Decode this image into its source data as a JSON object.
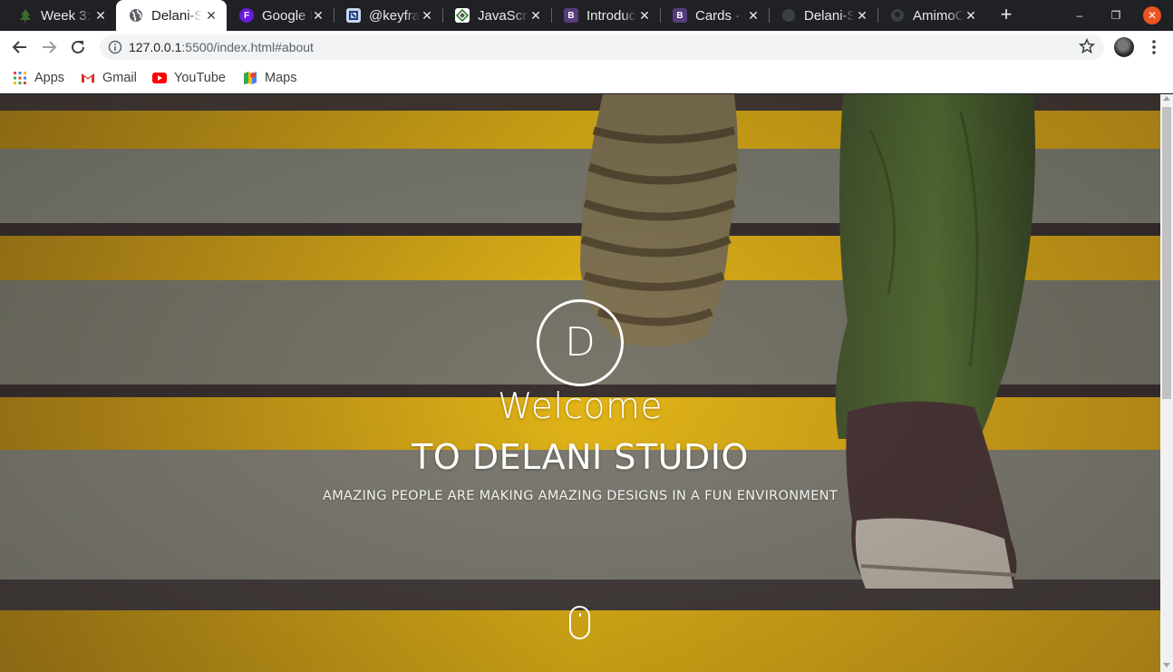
{
  "browser": {
    "tabs": [
      {
        "title": "Week 3:",
        "icon": "tree-favicon",
        "active": false
      },
      {
        "title": "Delani-S",
        "icon": "globe-favicon",
        "active": true
      },
      {
        "title": "Google F",
        "icon": "google-fonts-favicon",
        "active": false
      },
      {
        "title": "@keyfra",
        "icon": "keyframes-favicon",
        "active": false
      },
      {
        "title": "JavaScri",
        "icon": "javascript-favicon",
        "active": false
      },
      {
        "title": "Introduc",
        "icon": "bootstrap-favicon",
        "active": false
      },
      {
        "title": "Cards · B",
        "icon": "bootstrap-favicon",
        "active": false
      },
      {
        "title": "Delani-S",
        "icon": "globe-favicon",
        "active": false
      },
      {
        "title": "AmimoC",
        "icon": "github-favicon",
        "active": false
      }
    ],
    "tab_close_glyph": "✕",
    "new_tab_glyph": "+",
    "window_controls": {
      "minimize": "–",
      "maximize": "❐",
      "close": "✕"
    },
    "url": {
      "host": "127.0.0.1",
      "rest": ":5500/index.html#about"
    },
    "bookmarks": [
      {
        "label": "Apps",
        "icon": "apps-grid-icon"
      },
      {
        "label": "Gmail",
        "icon": "gmail-icon"
      },
      {
        "label": "YouTube",
        "icon": "youtube-icon"
      },
      {
        "label": "Maps",
        "icon": "maps-icon"
      }
    ]
  },
  "hero": {
    "logo_letter": "D",
    "welcome": "Welcome",
    "heading": "TO DELANI STUDIO",
    "tagline": "AMAZING PEOPLE ARE MAKING AMAZING DESIGNS IN A FUN ENVIRONMENT",
    "scroll_indicator": "mouse-scroll-icon"
  },
  "colors": {
    "stripe_yellow": "#e8b81a",
    "step_gray": "#7a7868",
    "tab_bar": "#202124",
    "close_orange": "#e95420"
  }
}
